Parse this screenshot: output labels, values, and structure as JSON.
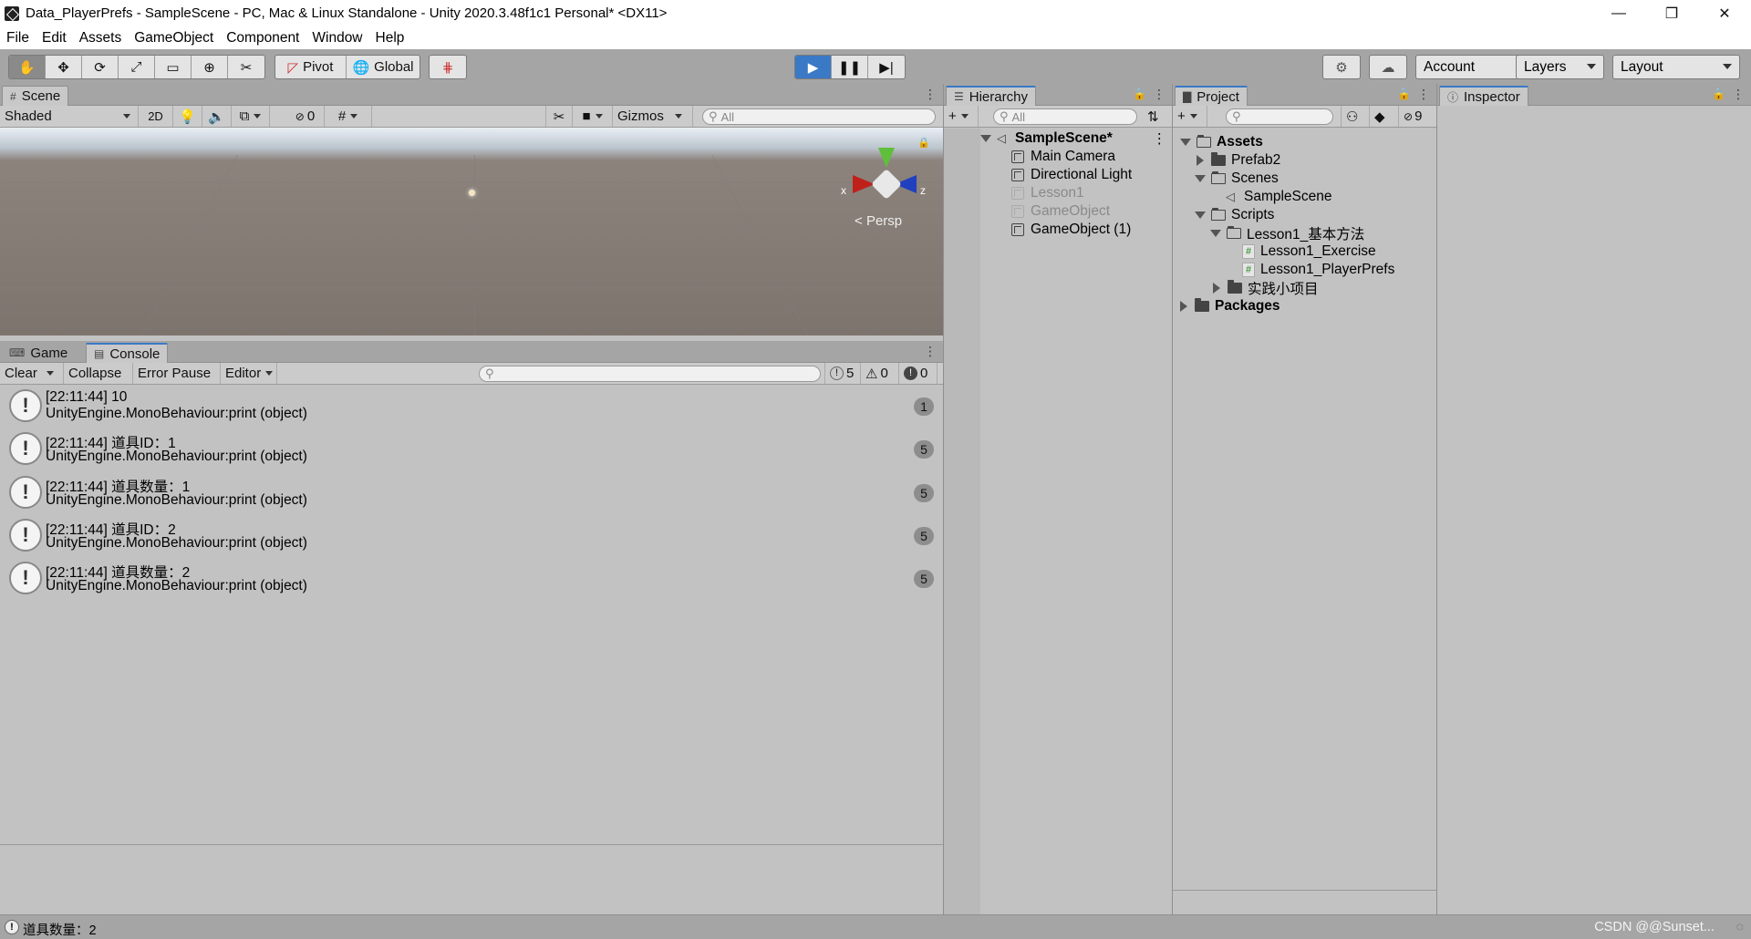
{
  "window": {
    "title": "Data_PlayerPrefs - SampleScene - PC, Mac & Linux Standalone - Unity 2020.3.48f1c1 Personal* <DX11>",
    "minimize": "—",
    "restore": "❐",
    "close": "✕"
  },
  "menu": [
    "File",
    "Edit",
    "Assets",
    "GameObject",
    "Component",
    "Window",
    "Help"
  ],
  "toolbar": {
    "pivot": "Pivot",
    "global": "Global",
    "account": "Account",
    "layers": "Layers",
    "layout": "Layout"
  },
  "scene": {
    "tab": "Scene",
    "shading": "Shaded",
    "mode_2d": "2D",
    "hidden_count": "0",
    "gizmos": "Gizmos",
    "search_placeholder": "All",
    "persp": "Persp",
    "axis_x": "x",
    "axis_z": "z"
  },
  "console": {
    "tab_game": "Game",
    "tab_console": "Console",
    "clear": "Clear",
    "collapse": "Collapse",
    "error_pause": "Error Pause",
    "editor": "Editor",
    "log_count": "5",
    "warn_count": "0",
    "error_count": "0",
    "entries": [
      {
        "line1": "[22:11:44] 10",
        "line2": "UnityEngine.MonoBehaviour:print (object)",
        "count": "1"
      },
      {
        "line1": "[22:11:44] 道具ID：1",
        "line2": "UnityEngine.MonoBehaviour:print (object)",
        "count": "5"
      },
      {
        "line1": "[22:11:44] 道具数量：1",
        "line2": "UnityEngine.MonoBehaviour:print (object)",
        "count": "5"
      },
      {
        "line1": "[22:11:44] 道具ID：2",
        "line2": "UnityEngine.MonoBehaviour:print (object)",
        "count": "5"
      },
      {
        "line1": "[22:11:44] 道具数量：2",
        "line2": "UnityEngine.MonoBehaviour:print (object)",
        "count": "5"
      }
    ]
  },
  "hierarchy": {
    "tab": "Hierarchy",
    "search_placeholder": "All",
    "scene_name": "SampleScene*",
    "items": [
      "Main Camera",
      "Directional Light",
      "Lesson1",
      "GameObject",
      "GameObject (1)"
    ]
  },
  "project": {
    "tab": "Project",
    "hidden_count": "9",
    "tree": {
      "assets": "Assets",
      "prefab2": "Prefab2",
      "scenes": "Scenes",
      "samplescene": "SampleScene",
      "scripts": "Scripts",
      "lesson1_folder": "Lesson1_基本方法",
      "lesson1_exercise": "Lesson1_Exercise",
      "lesson1_playerprefs": "Lesson1_PlayerPrefs",
      "practice": "实践小项目",
      "packages": "Packages"
    }
  },
  "inspector": {
    "tab": "Inspector"
  },
  "status": {
    "message": "道具数量：2",
    "watermark": "CSDN @@Sunset..."
  }
}
